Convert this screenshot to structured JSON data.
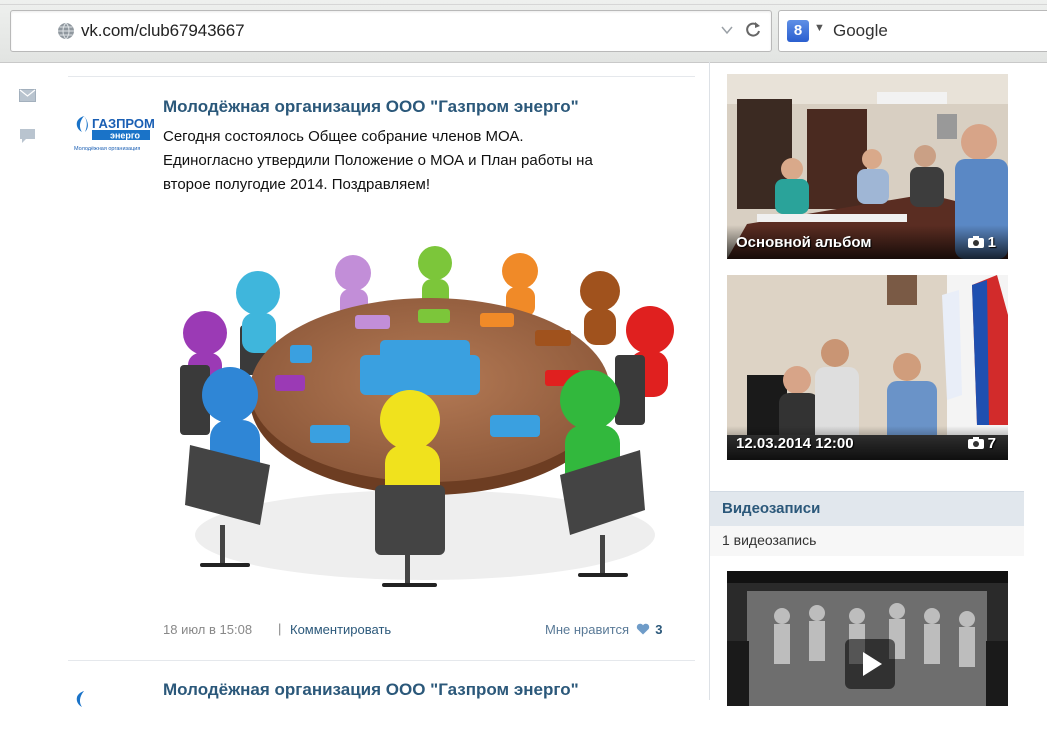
{
  "browser": {
    "url": "vk.com/club67943667",
    "search_engine": "Google"
  },
  "post": {
    "author": "Молодёжная организация ООО \"Газпром энерго\"",
    "logo_text": "ГАЗПРОМ энерго",
    "logo_subtext": "Молодёжная организация",
    "text_lines": [
      "Сегодня состоялось Общее собрание членов МОА.",
      "Единогласно утвердили Положение о МОА и План работы на",
      "второе полугодие 2014. Поздравляем!"
    ],
    "date": "18 июл в 15:08",
    "separator": "|",
    "comment_label": "Комментировать",
    "like_label": "Мне нравится",
    "like_count": "3"
  },
  "post2": {
    "author": "Молодёжная организация ООО \"Газпром энерго\""
  },
  "albums": [
    {
      "title": "Основной альбом",
      "count": "1"
    },
    {
      "title": "12.03.2014 12:00",
      "count": "7"
    }
  ],
  "videos": {
    "title": "Видеозаписи",
    "count_label": "1 видеозапись"
  },
  "colors": {
    "link": "#2b587a",
    "meta": "#888888",
    "videos_header_bg": "#e1e7ed"
  }
}
